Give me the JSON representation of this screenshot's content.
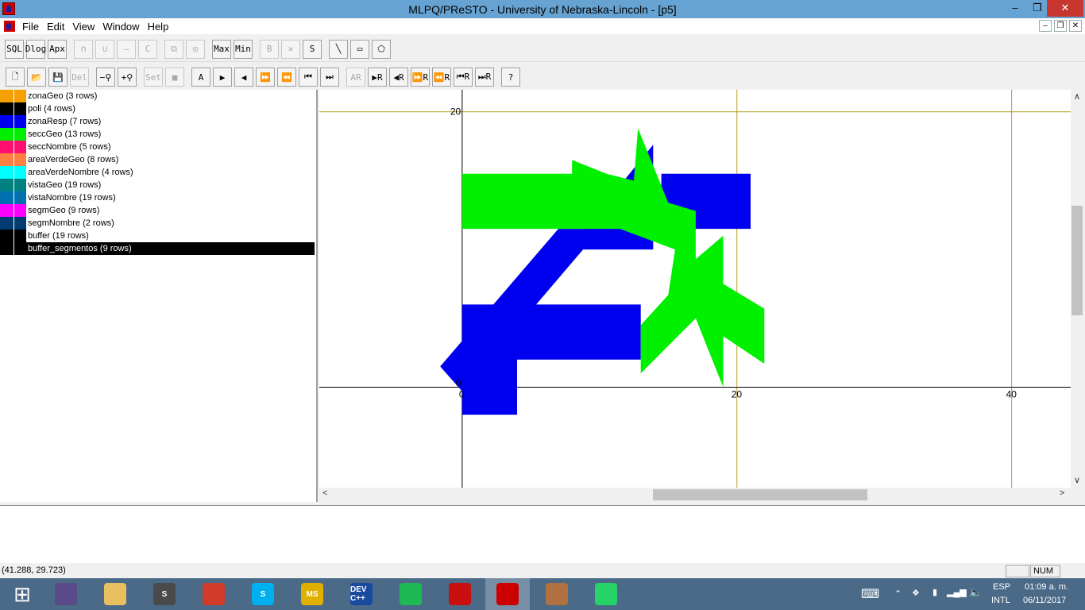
{
  "window": {
    "title": "MLPQ/PReSTO - University of Nebraska-Lincoln - [p5]",
    "min_glyph": "–",
    "max_glyph": "❐",
    "close_glyph": "✕"
  },
  "menu": {
    "items": [
      "File",
      "Edit",
      "View",
      "Window",
      "Help"
    ],
    "mdi_buttons": [
      "–",
      "❐",
      "✕"
    ]
  },
  "toolbar1": [
    {
      "name": "sql-button",
      "label": "SQL",
      "enabled": true
    },
    {
      "name": "dlog-button",
      "label": "Dlog",
      "enabled": true
    },
    {
      "name": "apx-button",
      "label": "Apx",
      "enabled": true
    },
    {
      "sep": true
    },
    {
      "name": "intersect-button",
      "label": "∩",
      "enabled": false
    },
    {
      "name": "union-button",
      "label": "∪",
      "enabled": false
    },
    {
      "name": "difference-button",
      "label": "—",
      "enabled": false
    },
    {
      "name": "complement-button",
      "label": "C",
      "enabled": false
    },
    {
      "sep": true
    },
    {
      "name": "area-button",
      "label": "⧉",
      "enabled": false
    },
    {
      "name": "buffer-button",
      "label": "◎",
      "enabled": false
    },
    {
      "sep": true
    },
    {
      "name": "max-button",
      "label": "Max",
      "enabled": true
    },
    {
      "name": "min-button",
      "label": "Min",
      "enabled": true
    },
    {
      "sep": true
    },
    {
      "name": "b-button",
      "label": "B",
      "enabled": false
    },
    {
      "name": "x-button",
      "label": "✕",
      "enabled": false
    },
    {
      "name": "s-button",
      "label": "S",
      "enabled": true
    },
    {
      "sep": true
    },
    {
      "name": "line-tool-button",
      "label": "╲",
      "enabled": true
    },
    {
      "name": "rect-tool-button",
      "label": "▭",
      "enabled": true
    },
    {
      "name": "polygon-tool-button",
      "label": "⬠",
      "enabled": true
    }
  ],
  "toolbar2": [
    {
      "name": "new-file-button",
      "label": "🗋",
      "enabled": true
    },
    {
      "name": "open-file-button",
      "label": "📂",
      "enabled": true
    },
    {
      "name": "save-file-button",
      "label": "💾",
      "enabled": true
    },
    {
      "name": "delete-button",
      "label": "Del",
      "enabled": false
    },
    {
      "sep": true
    },
    {
      "name": "zoom-out-button",
      "label": "−⚲",
      "enabled": true
    },
    {
      "name": "zoom-in-button",
      "label": "+⚲",
      "enabled": true
    },
    {
      "sep": true
    },
    {
      "name": "set-button",
      "label": "Set",
      "enabled": false
    },
    {
      "name": "color-button",
      "label": "■",
      "enabled": false
    },
    {
      "sep": true
    },
    {
      "name": "animate-button",
      "label": "A",
      "enabled": true
    },
    {
      "name": "play-button",
      "label": "▶",
      "enabled": true
    },
    {
      "name": "back-button",
      "label": "◀",
      "enabled": true
    },
    {
      "name": "fast-forward-button",
      "label": "⏩",
      "enabled": true
    },
    {
      "name": "rewind-button",
      "label": "⏪",
      "enabled": true
    },
    {
      "name": "first-button",
      "label": "⏮",
      "enabled": true
    },
    {
      "name": "last-button",
      "label": "⏭",
      "enabled": true
    },
    {
      "sep": true
    },
    {
      "name": "animate-r-button",
      "label": "AR",
      "enabled": false
    },
    {
      "name": "play-r-button",
      "label": "▶R",
      "enabled": true
    },
    {
      "name": "back-r-button",
      "label": "◀R",
      "enabled": true
    },
    {
      "name": "ff-r-button",
      "label": "⏩R",
      "enabled": true
    },
    {
      "name": "rew-r-button",
      "label": "⏪R",
      "enabled": true
    },
    {
      "name": "first-r-button",
      "label": "⏮R",
      "enabled": true
    },
    {
      "name": "last-r-button",
      "label": "⏭R",
      "enabled": true
    },
    {
      "sep": true
    },
    {
      "name": "help-button",
      "label": "?",
      "enabled": true
    }
  ],
  "layers": [
    {
      "label": "zonaGeo (3 rows)",
      "color": "#f5a000",
      "selected": false
    },
    {
      "label": "poli (4 rows)",
      "color": "#000000",
      "selected": false
    },
    {
      "label": "zonaResp (7 rows)",
      "color": "#0000ee",
      "selected": false
    },
    {
      "label": "seccGeo (13 rows)",
      "color": "#00ee00",
      "selected": false
    },
    {
      "label": "seccNombre (5 rows)",
      "color": "#ff1070",
      "selected": false
    },
    {
      "label": "areaVerdeGeo (8 rows)",
      "color": "#ff8040",
      "selected": false
    },
    {
      "label": "areaVerdeNombre (4 rows)",
      "color": "#00ffff",
      "selected": false
    },
    {
      "label": "vistaGeo (19 rows)",
      "color": "#008080",
      "selected": false
    },
    {
      "label": "vistaNombre (19 rows)",
      "color": "#0070b0",
      "selected": false
    },
    {
      "label": "segmGeo (9 rows)",
      "color": "#ff00ff",
      "selected": false
    },
    {
      "label": "segmNombre (2 rows)",
      "color": "#003c70",
      "selected": false
    },
    {
      "label": "buffer (19 rows)",
      "color": "#000000",
      "selected": false
    },
    {
      "label": "buffer_segmentos (9 rows)",
      "color": "#000000",
      "selected": true
    }
  ],
  "plot": {
    "x_ticks": [
      "0",
      "20",
      "40"
    ],
    "y_ticks": [
      "0",
      "20"
    ],
    "x_range": [
      -10.4,
      44.3
    ],
    "y_range": [
      -7.3,
      21.6
    ],
    "grid_color": "#b8a020",
    "axis_color": "#000000",
    "blue": "#0000f0",
    "green": "#00f000",
    "blue_shapes": [
      [
        [
          13.9,
          17.6
        ],
        [
          8.9,
          11.5
        ],
        [
          7.0,
          11.5
        ],
        [
          -1.6,
          1.5
        ],
        [
          0.0,
          -0.3
        ],
        [
          8.8,
          10.0
        ],
        [
          13.9,
          10.0
        ]
      ],
      [
        [
          7.0,
          11.5
        ],
        [
          14.5,
          11.5
        ],
        [
          14.5,
          15.5
        ],
        [
          21.0,
          15.5
        ],
        [
          21.0,
          11.5
        ],
        [
          7.0,
          11.5
        ]
      ],
      [
        [
          0.0,
          6.0
        ],
        [
          13.0,
          6.0
        ],
        [
          13.0,
          2.0
        ],
        [
          4.0,
          2.0
        ],
        [
          4.0,
          -2.0
        ],
        [
          0.0,
          -2.0
        ]
      ]
    ],
    "green_shapes": [
      [
        [
          0.0,
          15.5
        ],
        [
          8.0,
          15.5
        ],
        [
          8.0,
          16.5
        ],
        [
          10.5,
          15.5
        ],
        [
          12.5,
          15.0
        ],
        [
          12.8,
          18.8
        ],
        [
          15.0,
          13.4
        ],
        [
          17.0,
          12.8
        ],
        [
          17.0,
          10.0
        ],
        [
          17.0,
          9.3
        ],
        [
          19.0,
          11.0
        ],
        [
          19.0,
          7.5
        ],
        [
          22.0,
          5.7
        ],
        [
          22.0,
          1.7
        ],
        [
          19.0,
          3.7
        ],
        [
          19.0,
          0.0
        ],
        [
          17.0,
          5.0
        ],
        [
          13.0,
          1.0
        ],
        [
          13.0,
          4.5
        ],
        [
          15.0,
          6.7
        ],
        [
          15.5,
          10.0
        ],
        [
          11.5,
          11.5
        ],
        [
          8.0,
          11.5
        ],
        [
          0.0,
          11.5
        ]
      ]
    ]
  },
  "status": {
    "coords": "(41.288, 29.723)",
    "num": "NUM"
  },
  "taskbar": {
    "apps": [
      {
        "name": "start-button",
        "label": "",
        "color": "#4a6a88"
      },
      {
        "name": "cat-app-icon",
        "label": "",
        "color": "#5a4a8a"
      },
      {
        "name": "file-explorer-icon",
        "label": "",
        "color": "#e8c060"
      },
      {
        "name": "sublime-icon",
        "label": "S",
        "color": "#4a4a4a"
      },
      {
        "name": "chrome-icon",
        "label": "",
        "color": "#d23a2a"
      },
      {
        "name": "skype-icon",
        "label": "S",
        "color": "#00aff0"
      },
      {
        "name": "msp-icon",
        "label": "MS",
        "color": "#e0b000"
      },
      {
        "name": "devcpp-icon",
        "label": "DEV C++",
        "color": "#1a4aa0"
      },
      {
        "name": "spotify-icon",
        "label": "",
        "color": "#1db954"
      },
      {
        "name": "acrobat-icon",
        "label": "",
        "color": "#c81010"
      },
      {
        "name": "mlpq-icon",
        "label": "",
        "color": "#cc0000"
      },
      {
        "name": "paint-icon",
        "label": "",
        "color": "#b07040"
      },
      {
        "name": "whatsapp-icon",
        "label": "",
        "color": "#25d366"
      }
    ],
    "lang_top": "ESP",
    "lang_bottom": "INTL",
    "time": "01:09 a. m.",
    "date": "06/11/2017"
  }
}
